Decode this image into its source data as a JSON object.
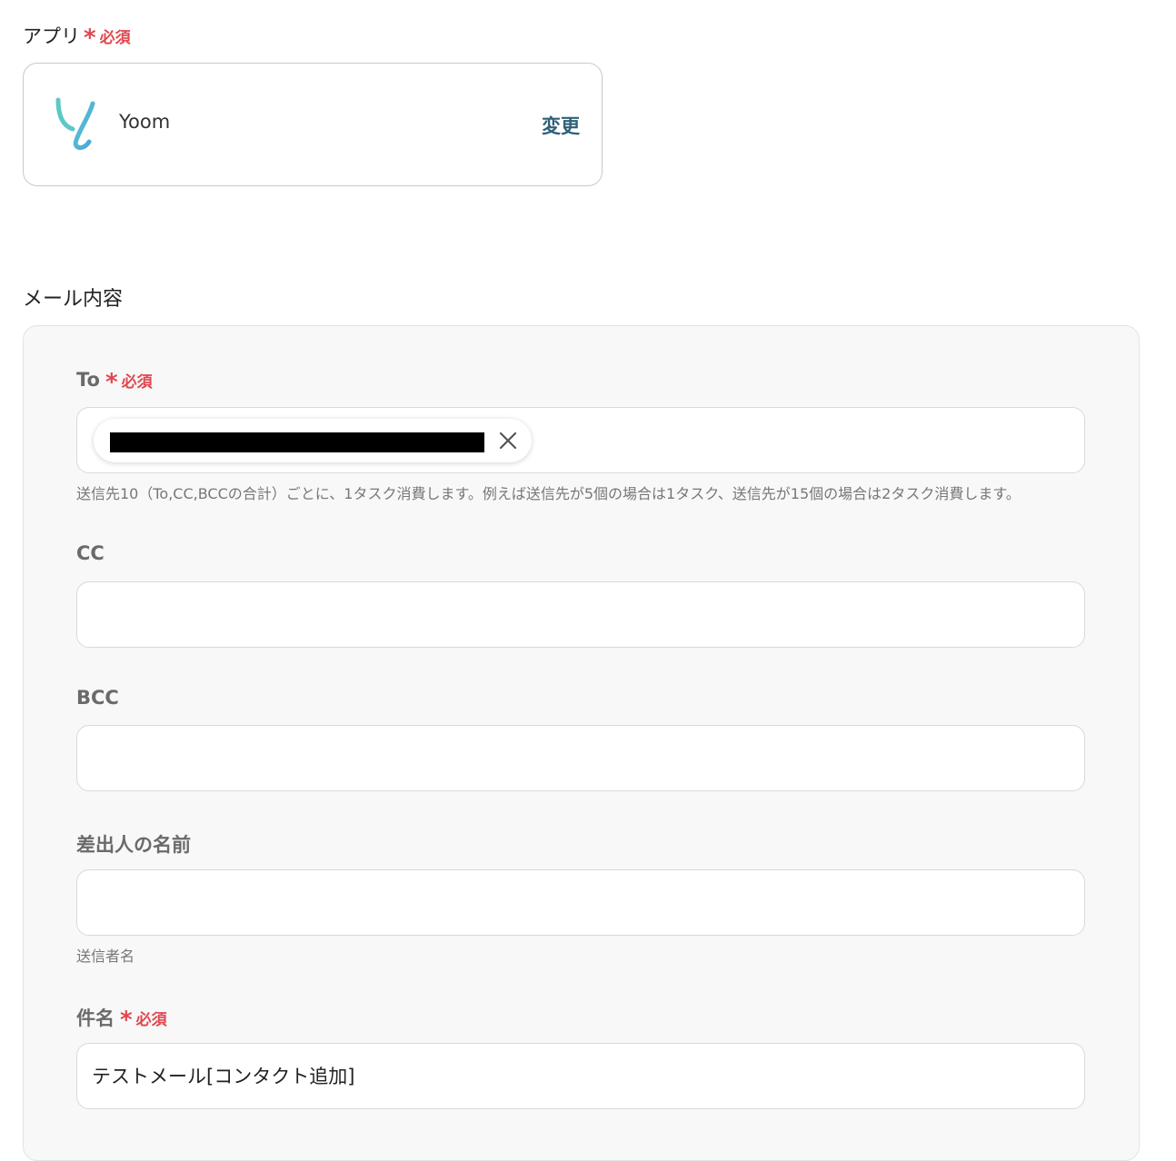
{
  "app_section": {
    "label": "アプリ",
    "required_mark": "＊",
    "required_text": "必須",
    "app_name": "Yoom",
    "change_label": "変更",
    "logo_icon": "yoom-logo-icon"
  },
  "mail_section": {
    "title": "メール内容",
    "to": {
      "label": "To",
      "required_text": "必須",
      "chip_value": "[redacted]",
      "hint": "送信先10（To,CC,BCCの合計）ごとに、1タスク消費します。例えば送信先が5個の場合は1タスク、送信先が15個の場合は2タスク消費します。"
    },
    "cc": {
      "label": "CC",
      "value": ""
    },
    "bcc": {
      "label": "BCC",
      "value": ""
    },
    "sender_name": {
      "label": "差出人の名前",
      "value": "",
      "hint": "送信者名"
    },
    "subject": {
      "label": "件名",
      "required_text": "必須",
      "value": "テストメール[コンタクト追加]"
    }
  },
  "colors": {
    "required": "#e0474f",
    "change_link": "#2e6179",
    "panel_bg": "#f8f8f8",
    "logo_teal": "#5bc8c8",
    "logo_blue": "#4aa3e0"
  }
}
